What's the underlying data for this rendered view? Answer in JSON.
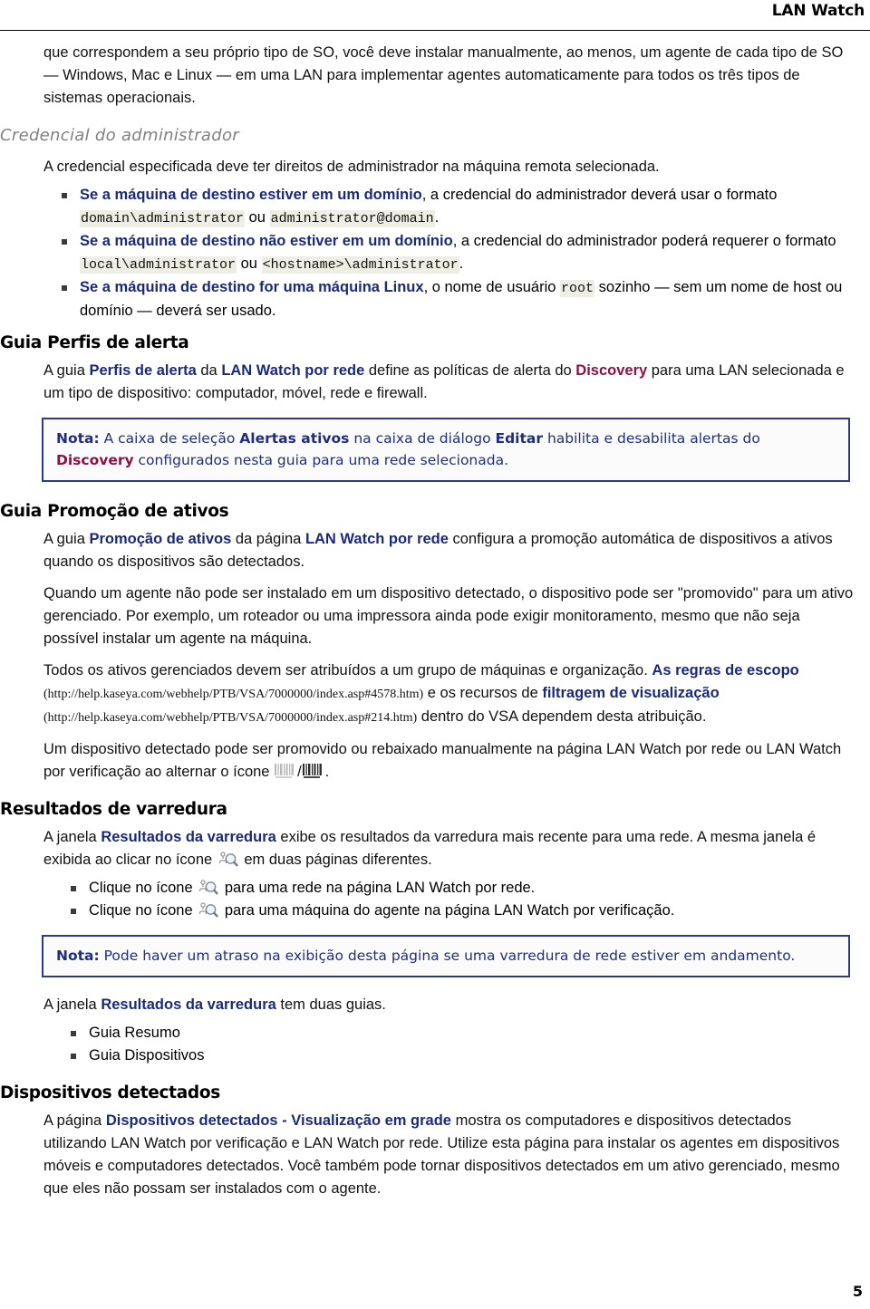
{
  "header": {
    "title": "LAN Watch"
  },
  "footer": {
    "page_number": "5"
  },
  "intro": {
    "text_1": "que correspondem a seu próprio tipo de SO, você deve instalar manualmente, ao menos, um agente de cada tipo de SO — Windows, Mac e Linux — em uma LAN para implementar agentes automaticamente para todos os três tipos de sistemas operacionais."
  },
  "credential_section": {
    "heading": "Credencial do administrador",
    "lead": "A credencial especificada deve ter direitos de administrador na máquina remota selecionada.",
    "bullets": [
      {
        "bold": "Se a máquina de destino estiver em um domínio",
        "text_a": ", a credencial do administrador deverá usar o formato ",
        "code_1": "domain\\administrator",
        "text_b": " ou ",
        "code_2": "administrator@domain",
        "text_c": "."
      },
      {
        "bold": "Se a máquina de destino não estiver em um domínio",
        "text_a": ", a credencial do administrador poderá requerer o formato ",
        "code_1": "local\\administrator",
        "text_b": " ou ",
        "code_2": "<hostname>\\administrator",
        "text_c": "."
      },
      {
        "bold": "Se a máquina de destino for uma máquina Linux",
        "text_a": ", o nome de usuário ",
        "code_1": "root",
        "text_b": " sozinho — sem um nome de host ou domínio — deverá ser usado.",
        "code_2": "",
        "text_c": ""
      }
    ]
  },
  "alert_profiles_section": {
    "heading": "Guia Perfis de alerta",
    "para_a": "A guia ",
    "link_1": "Perfis de alerta",
    "para_b": " da ",
    "link_2": "LAN Watch por rede",
    "para_c": " define as políticas de alerta do ",
    "link_3": "Discovery",
    "para_d": " para uma LAN selecionada e um tipo de dispositivo: computador, móvel, rede e firewall.",
    "note": {
      "label": "Nota:",
      "text_a": " A caixa de seleção ",
      "bold_1": "Alertas ativos",
      "text_b": " na caixa de diálogo ",
      "bold_2": "Editar",
      "text_c": " habilita e desabilita alertas do ",
      "bold_3": "Discovery",
      "text_d": " configurados nesta guia para uma rede selecionada."
    }
  },
  "asset_promotion_section": {
    "heading": "Guia Promoção de ativos",
    "para1_a": "A guia ",
    "para1_link1": "Promoção de ativos",
    "para1_b": " da página ",
    "para1_link2": "LAN Watch por rede",
    "para1_c": " configura a promoção automática de dispositivos a ativos quando os dispositivos são detectados.",
    "para2": "Quando um agente não pode ser instalado em um dispositivo detectado, o dispositivo pode ser \"promovido\" para um ativo gerenciado. Por exemplo, um roteador ou uma impressora ainda pode exigir monitoramento, mesmo que não seja possível instalar um agente na máquina.",
    "para3_a": "Todos os ativos gerenciados devem ser atribuídos a um grupo de máquinas e organização. ",
    "para3_link1": "As regras de escopo",
    "para3_url1": "(http://help.kaseya.com/webhelp/PTB/VSA/7000000/index.asp#4578.htm)",
    "para3_b": " e os recursos de ",
    "para3_link2": "filtragem de visualização",
    "para3_url2": "(http://help.kaseya.com/webhelp/PTB/VSA/7000000/index.asp#214.htm)",
    "para3_c": " dentro do VSA dependem desta atribuição.",
    "para4_a": "Um dispositivo detectado pode ser promovido ou rebaixado manualmente na página LAN Watch por rede ou LAN Watch por verificação ao alternar o ícone ",
    "para4_icon_1": "barcode-inactive-icon",
    "para4_sep": "/",
    "para4_icon_2": "barcode-active-icon",
    "para4_b": "."
  },
  "scan_results_section": {
    "heading": "Resultados de varredura",
    "para_a": "A janela ",
    "para_link": "Resultados da varredura",
    "para_b": " exibe os resultados da varredura mais recente para uma rede. A mesma janela é exibida ao clicar no ícone ",
    "para_icon": "scan-results-icon",
    "para_c": " em duas páginas diferentes.",
    "bullets": [
      {
        "text_a": "Clique no ícone ",
        "icon": "scan-results-icon",
        "text_b": " para uma rede na página LAN Watch por rede."
      },
      {
        "text_a": "Clique no ícone ",
        "icon": "scan-results-icon",
        "text_b": " para uma máquina do agente na página LAN Watch por verificação."
      }
    ],
    "note": {
      "label": "Nota:",
      "text": " Pode haver um atraso na exibição desta página se uma varredura de rede estiver em andamento."
    },
    "tabs_intro_a": "A janela ",
    "tabs_intro_link": "Resultados da varredura",
    "tabs_intro_b": " tem duas guias.",
    "tabs": [
      "Guia Resumo",
      "Guia Dispositivos"
    ]
  },
  "detected_devices_section": {
    "heading": "Dispositivos detectados",
    "para_a": "A página ",
    "para_link": "Dispositivos detectados - Visualização em grade",
    "para_b": " mostra os computadores e dispositivos detectados utilizando LAN Watch por verificação e LAN Watch por rede. Utilize esta página para instalar os agentes em dispositivos móveis e computadores detectados. Você também pode tornar dispositivos detectados em um ativo gerenciado, mesmo que eles não possam ser instalados com o agente."
  },
  "colors": {
    "navy": "#1a2a7a",
    "crimson": "#8c1144",
    "gray_heading": "#808080",
    "note_border": "#2a3b8f",
    "code_bg": "#eeeee4"
  }
}
